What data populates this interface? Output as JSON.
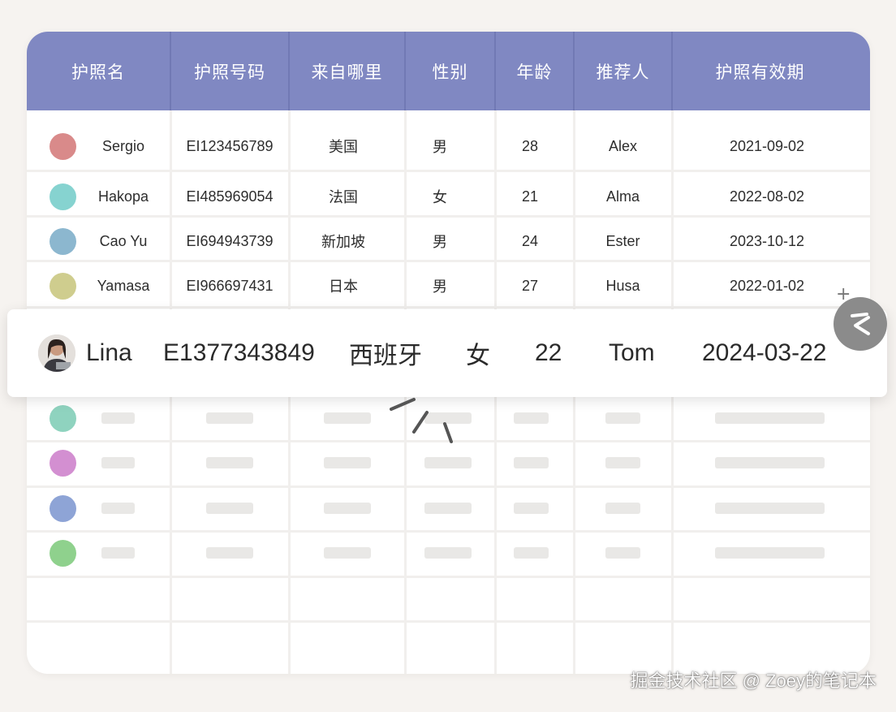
{
  "header": [
    "护照名",
    "护照号码",
    "来自哪里",
    "性别",
    "年龄",
    "推荐人",
    "护照有效期"
  ],
  "rows": [
    {
      "name": "Sergio",
      "passport": "EI123456789",
      "from": "美国",
      "gender": "男",
      "age": "28",
      "referrer": "Alex",
      "expiry": "2021-09-02",
      "color": "#d98a8a"
    },
    {
      "name": "Hakopa",
      "passport": "EI485969054",
      "from": "法国",
      "gender": "女",
      "age": "21",
      "referrer": "Alma",
      "expiry": "2022-08-02",
      "color": "#86d3d0"
    },
    {
      "name": "Cao Yu",
      "passport": "EI694943739",
      "from": "新加坡",
      "gender": "男",
      "age": "24",
      "referrer": "Ester",
      "expiry": "2023-10-12",
      "color": "#8cb7cf"
    },
    {
      "name": "Yamasa",
      "passport": "EI966697431",
      "from": "日本",
      "gender": "男",
      "age": "27",
      "referrer": "Husa",
      "expiry": "2022-01-02",
      "color": "#cfcd8e"
    }
  ],
  "highlight": {
    "name": "Lina",
    "passport": "E1377343849",
    "from": "西班牙",
    "gender": "女",
    "age": "22",
    "referrer": "Tom",
    "expiry": "2024-03-22"
  },
  "placeholder_colors": [
    "#8fd3bf",
    "#d38fd1",
    "#8ea4d6",
    "#8fd18d"
  ],
  "colors": {
    "header_bg": "#8088c2",
    "page_bg": "#f6f3f0"
  },
  "icons": {
    "fab": "chevron-left-icon",
    "sparkle": "sparkle-icon",
    "plus": "plus-icon"
  },
  "watermark": "掘金技术社区 @ Zoey的笔记本"
}
